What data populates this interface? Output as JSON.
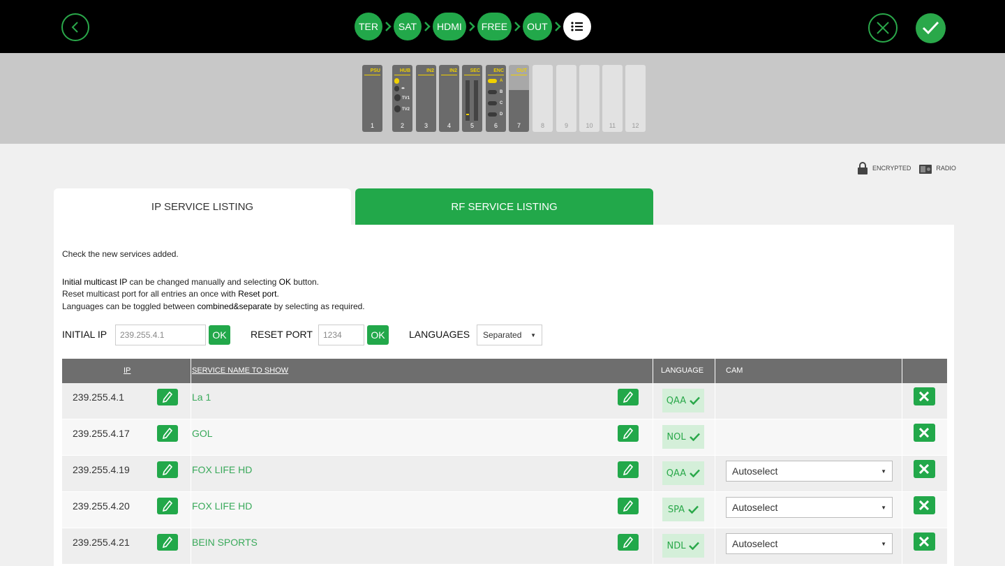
{
  "wizard": {
    "steps": [
      "TER",
      "SAT",
      "HDMI",
      "FREE",
      "OUT"
    ],
    "colors": {
      "accent": "#22a84a",
      "topbar": "#000000"
    }
  },
  "rack": {
    "slots": [
      {
        "num": "1",
        "label": "PSU"
      },
      {
        "num": "2",
        "label": "HUB",
        "ports": [
          "TV1",
          "TV2"
        ]
      },
      {
        "num": "3",
        "label": "IN2"
      },
      {
        "num": "4",
        "label": "IN2"
      },
      {
        "num": "5",
        "label": "SEC"
      },
      {
        "num": "6",
        "label": "ENC",
        "ports": [
          "A",
          "B",
          "C",
          "D"
        ]
      },
      {
        "num": "7",
        "label": "OUT"
      },
      {
        "num": "8"
      },
      {
        "num": "9"
      },
      {
        "num": "10"
      },
      {
        "num": "11"
      },
      {
        "num": "12"
      }
    ]
  },
  "legend": {
    "encrypted": "ENCRYPTED",
    "radio": "RADIO"
  },
  "tabs": {
    "ip": "IP SERVICE LISTING",
    "rf": "RF SERVICE LISTING"
  },
  "help": {
    "line1": "Check the new services added.",
    "line2_bold": "Initial multicast IP",
    "line2_rest": " can be changed manually and selecting ",
    "line2_bold2": "OK",
    "line2_end": " button.",
    "line3_start": "Reset multicast port for all entries an once with ",
    "line3_bold": "Reset port",
    "line3_end": ".",
    "line4_start": "Languages can be toggled between ",
    "line4_bold": "combined&separate",
    "line4_end": " by selecting as required."
  },
  "controls": {
    "initial_ip_label": "INITIAL IP",
    "initial_ip_value": "239.255.4.1",
    "ok": "OK",
    "reset_port_label": "RESET PORT",
    "reset_port_value": "1234",
    "languages_label": "LANGUAGES",
    "languages_value": "Separated"
  },
  "table": {
    "headers": {
      "ip": "IP",
      "name": "SERVICE NAME TO SHOW",
      "language": "LANGUAGE",
      "cam": "CAM"
    },
    "rows": [
      {
        "ip": "239.255.4.1",
        "name": "La 1",
        "language": "QAA",
        "cam": ""
      },
      {
        "ip": "239.255.4.17",
        "name": "GOL",
        "language": "NOL",
        "cam": ""
      },
      {
        "ip": "239.255.4.19",
        "name": "FOX LIFE HD",
        "language": "QAA",
        "cam": "Autoselect"
      },
      {
        "ip": "239.255.4.20",
        "name": "FOX LIFE HD",
        "language": "SPA",
        "cam": "Autoselect"
      },
      {
        "ip": "239.255.4.21",
        "name": "BEIN SPORTS",
        "language": "NDL",
        "cam": "Autoselect"
      }
    ]
  }
}
